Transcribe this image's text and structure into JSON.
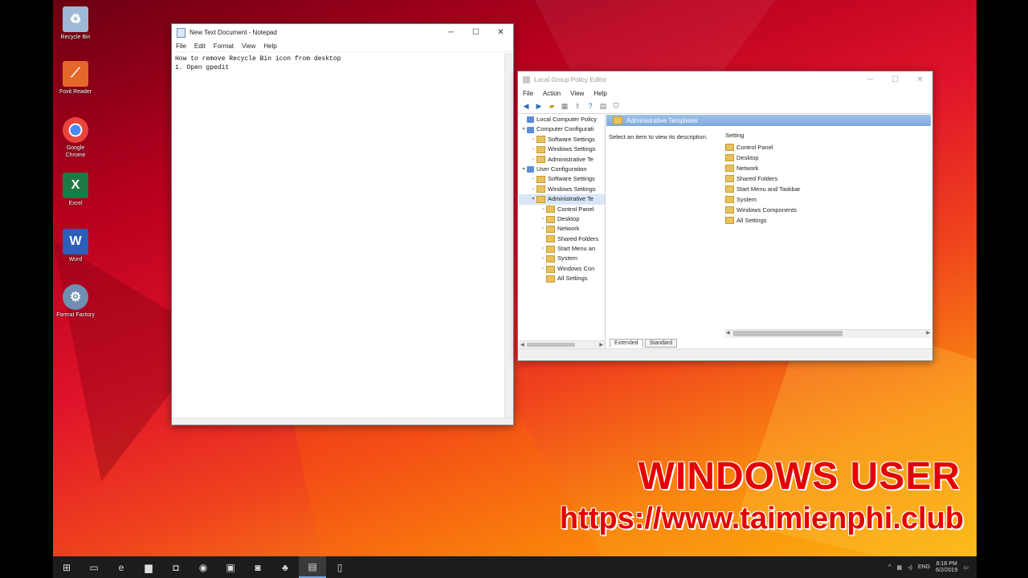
{
  "desktop": {
    "icons": [
      {
        "label": "Recycle Bin",
        "icon": "recycle-bin-icon",
        "color": "#9fb8d6"
      },
      {
        "label": "Foxit Reader",
        "icon": "foxit-reader-icon",
        "color": "#e5682b"
      },
      {
        "label": "Google Chrome",
        "icon": "chrome-icon",
        "color": "#2f8f46"
      },
      {
        "label": "Excel",
        "icon": "excel-icon",
        "color": "#1e7a45"
      },
      {
        "label": "Word",
        "icon": "word-icon",
        "color": "#2b5fb8"
      },
      {
        "label": "Format Factory",
        "icon": "format-factory-icon",
        "color": "#6e8fb0"
      }
    ]
  },
  "notepad": {
    "title": "New Text Document - Notepad",
    "menu": [
      "File",
      "Edit",
      "Format",
      "View",
      "Help"
    ],
    "lines": [
      "How to remove Recycle Bin icon from desktop",
      "",
      "1. Open gpedit"
    ]
  },
  "gpedit": {
    "title": "Local Group Policy Editor",
    "menu": [
      "File",
      "Action",
      "View",
      "Help"
    ],
    "tree": [
      {
        "label": "Local Computer Policy",
        "depth": 0,
        "type": "policy",
        "twisty": ""
      },
      {
        "label": "Computer Configurati",
        "depth": 0,
        "type": "pc",
        "twisty": "▾"
      },
      {
        "label": "Software Settings",
        "depth": 1,
        "type": "folder",
        "twisty": "›"
      },
      {
        "label": "Windows Settings",
        "depth": 1,
        "type": "folder",
        "twisty": "›"
      },
      {
        "label": "Administrative Te",
        "depth": 1,
        "type": "folder",
        "twisty": "›"
      },
      {
        "label": "User Configuration",
        "depth": 0,
        "type": "pc",
        "twisty": "▾"
      },
      {
        "label": "Software Settings",
        "depth": 1,
        "type": "folder",
        "twisty": "›"
      },
      {
        "label": "Windows Settings",
        "depth": 1,
        "type": "folder",
        "twisty": "›"
      },
      {
        "label": "Administrative Te",
        "depth": 1,
        "type": "folder",
        "twisty": "▾",
        "selected": true
      },
      {
        "label": "Control Panel",
        "depth": 2,
        "type": "folder",
        "twisty": "›"
      },
      {
        "label": "Desktop",
        "depth": 2,
        "type": "folder",
        "twisty": "›"
      },
      {
        "label": "Network",
        "depth": 2,
        "type": "folder",
        "twisty": "›"
      },
      {
        "label": "Shared Folders",
        "depth": 2,
        "type": "folder",
        "twisty": ""
      },
      {
        "label": "Start Menu an",
        "depth": 2,
        "type": "folder",
        "twisty": "›"
      },
      {
        "label": "System",
        "depth": 2,
        "type": "folder",
        "twisty": "›"
      },
      {
        "label": "Windows Con",
        "depth": 2,
        "type": "folder",
        "twisty": "›"
      },
      {
        "label": "All Settings",
        "depth": 2,
        "type": "folder",
        "twisty": ""
      }
    ],
    "header": "Administrative Templates",
    "description": "Select an item to view its description.",
    "column_header": "Setting",
    "settings": [
      "Control Panel",
      "Desktop",
      "Network",
      "Shared Folders",
      "Start Menu and Taskbar",
      "System",
      "Windows Components",
      "All Settings"
    ],
    "tabs": [
      "Extended",
      "Standard"
    ]
  },
  "watermark": {
    "line1": "WINDOWS USER",
    "line2": "https://www.taimienphi.club"
  },
  "taskbar": {
    "buttons": [
      {
        "name": "start-button",
        "glyph": "⊞"
      },
      {
        "name": "task-view-button",
        "glyph": "▭"
      },
      {
        "name": "edge-button",
        "glyph": "e"
      },
      {
        "name": "file-explorer-button",
        "glyph": "▆"
      },
      {
        "name": "store-button",
        "glyph": "◘"
      },
      {
        "name": "chrome-button",
        "glyph": "◉"
      },
      {
        "name": "app-button",
        "glyph": "▣"
      },
      {
        "name": "app2-button",
        "glyph": "◙"
      },
      {
        "name": "network-app-button",
        "glyph": "♣"
      },
      {
        "name": "gpedit-button",
        "glyph": "▤"
      },
      {
        "name": "notepad-button",
        "glyph": "▯"
      }
    ],
    "tray": {
      "language": "ENG",
      "time": "8:18 PM",
      "date": "6/2/2019"
    }
  }
}
